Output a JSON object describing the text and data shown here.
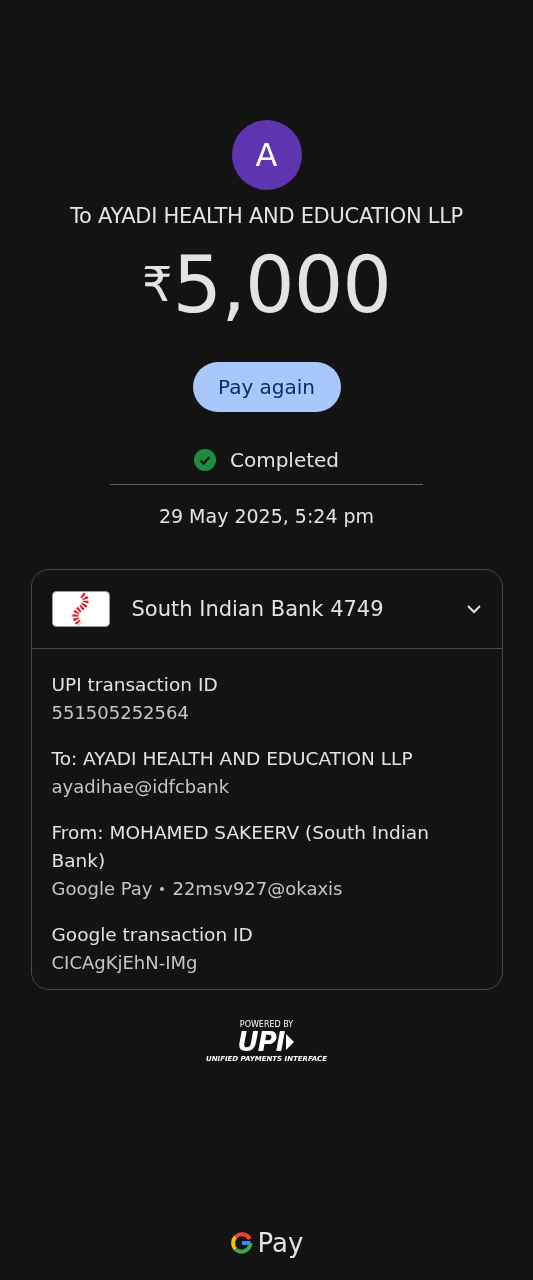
{
  "payee": {
    "avatar_letter": "A",
    "title": "To AYADI HEALTH AND EDUCATION LLP"
  },
  "amount": {
    "currency": "₹",
    "value": "5,000"
  },
  "pay_again_button": "Pay again",
  "status": {
    "label": "Completed",
    "completed": true
  },
  "datetime": "29 May 2025, 5:24 pm",
  "card": {
    "account": "South Indian Bank 4749",
    "expanded": true,
    "details": [
      {
        "label": "UPI transaction ID",
        "lines": [
          "551505252564"
        ]
      },
      {
        "label": "To: AYADI HEALTH AND EDUCATION LLP",
        "lines": [
          "ayadihae@idfcbank"
        ]
      },
      {
        "label": "From: MOHAMED SAKEERV (South Indian Bank)",
        "lines": [
          "Google Pay",
          "22msv927@okaxis"
        ]
      },
      {
        "label": "Google transaction ID",
        "lines": [
          "CICAgKjEhN-IMg"
        ]
      }
    ]
  },
  "upi_badge": {
    "powered_by": "POWERED BY",
    "logo": "UPI",
    "tagline": "UNIFIED PAYMENTS INTERFACE"
  },
  "footer": {
    "brand": "Pay"
  }
}
